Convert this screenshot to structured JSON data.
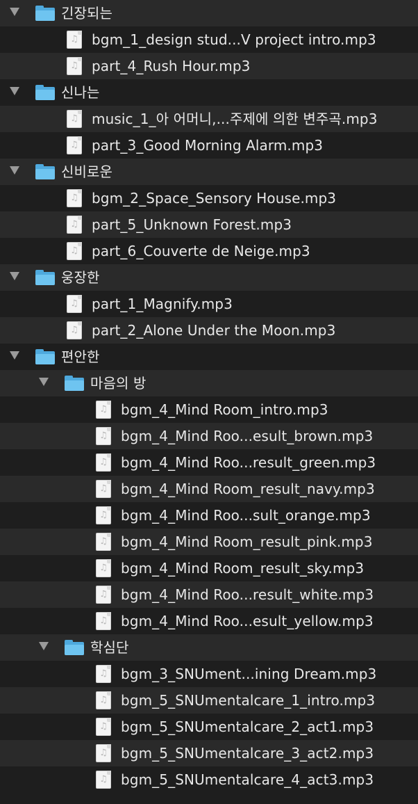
{
  "items": [
    {
      "kind": "folder",
      "depth": 0,
      "label": "긴장되는",
      "expanded": true
    },
    {
      "kind": "file",
      "depth": 1,
      "label": "bgm_1_design stud...V project intro.mp3"
    },
    {
      "kind": "file",
      "depth": 1,
      "label": "part_4_Rush Hour.mp3"
    },
    {
      "kind": "folder",
      "depth": 0,
      "label": "신나는",
      "expanded": true
    },
    {
      "kind": "file",
      "depth": 1,
      "label": "music_1_아 어머니,...주제에 의한 변주곡.mp3"
    },
    {
      "kind": "file",
      "depth": 1,
      "label": "part_3_Good Morning Alarm.mp3"
    },
    {
      "kind": "folder",
      "depth": 0,
      "label": "신비로운",
      "expanded": true
    },
    {
      "kind": "file",
      "depth": 1,
      "label": "bgm_2_Space_Sensory House.mp3"
    },
    {
      "kind": "file",
      "depth": 1,
      "label": "part_5_Unknown Forest.mp3"
    },
    {
      "kind": "file",
      "depth": 1,
      "label": "part_6_Couverte de Neige.mp3"
    },
    {
      "kind": "folder",
      "depth": 0,
      "label": "웅장한",
      "expanded": true
    },
    {
      "kind": "file",
      "depth": 1,
      "label": "part_1_Magnify.mp3"
    },
    {
      "kind": "file",
      "depth": 1,
      "label": "part_2_Alone Under the Moon.mp3"
    },
    {
      "kind": "folder",
      "depth": 0,
      "label": "편안한",
      "expanded": true
    },
    {
      "kind": "folder",
      "depth": 1,
      "label": "마음의 방",
      "expanded": true
    },
    {
      "kind": "file",
      "depth": 2,
      "label": "bgm_4_Mind Room_intro.mp3"
    },
    {
      "kind": "file",
      "depth": 2,
      "label": "bgm_4_Mind Roo...esult_brown.mp3"
    },
    {
      "kind": "file",
      "depth": 2,
      "label": "bgm_4_Mind Roo...result_green.mp3"
    },
    {
      "kind": "file",
      "depth": 2,
      "label": "bgm_4_Mind Room_result_navy.mp3"
    },
    {
      "kind": "file",
      "depth": 2,
      "label": "bgm_4_Mind Roo...sult_orange.mp3"
    },
    {
      "kind": "file",
      "depth": 2,
      "label": "bgm_4_Mind Room_result_pink.mp3"
    },
    {
      "kind": "file",
      "depth": 2,
      "label": "bgm_4_Mind Room_result_sky.mp3"
    },
    {
      "kind": "file",
      "depth": 2,
      "label": "bgm_4_Mind Roo...result_white.mp3"
    },
    {
      "kind": "file",
      "depth": 2,
      "label": "bgm_4_Mind Roo...esult_yellow.mp3"
    },
    {
      "kind": "folder",
      "depth": 1,
      "label": "학심단",
      "expanded": true
    },
    {
      "kind": "file",
      "depth": 2,
      "label": "bgm_3_SNUment...ining Dream.mp3"
    },
    {
      "kind": "file",
      "depth": 2,
      "label": "bgm_5_SNUmentalcare_1_intro.mp3"
    },
    {
      "kind": "file",
      "depth": 2,
      "label": "bgm_5_SNUmentalcare_2_act1.mp3"
    },
    {
      "kind": "file",
      "depth": 2,
      "label": "bgm_5_SNUmentalcare_3_act2.mp3"
    },
    {
      "kind": "file",
      "depth": 2,
      "label": "bgm_5_SNUmentalcare_4_act3.mp3"
    }
  ],
  "colors": {
    "background": "#1e1e1e",
    "row_alt": "#2a2a2a",
    "folder": "#6ec4f0",
    "text": "#e8e8e8"
  },
  "icons": {
    "folder": "folder-icon",
    "file": "audio-file-icon",
    "disclosure": "disclosure-triangle-icon"
  }
}
